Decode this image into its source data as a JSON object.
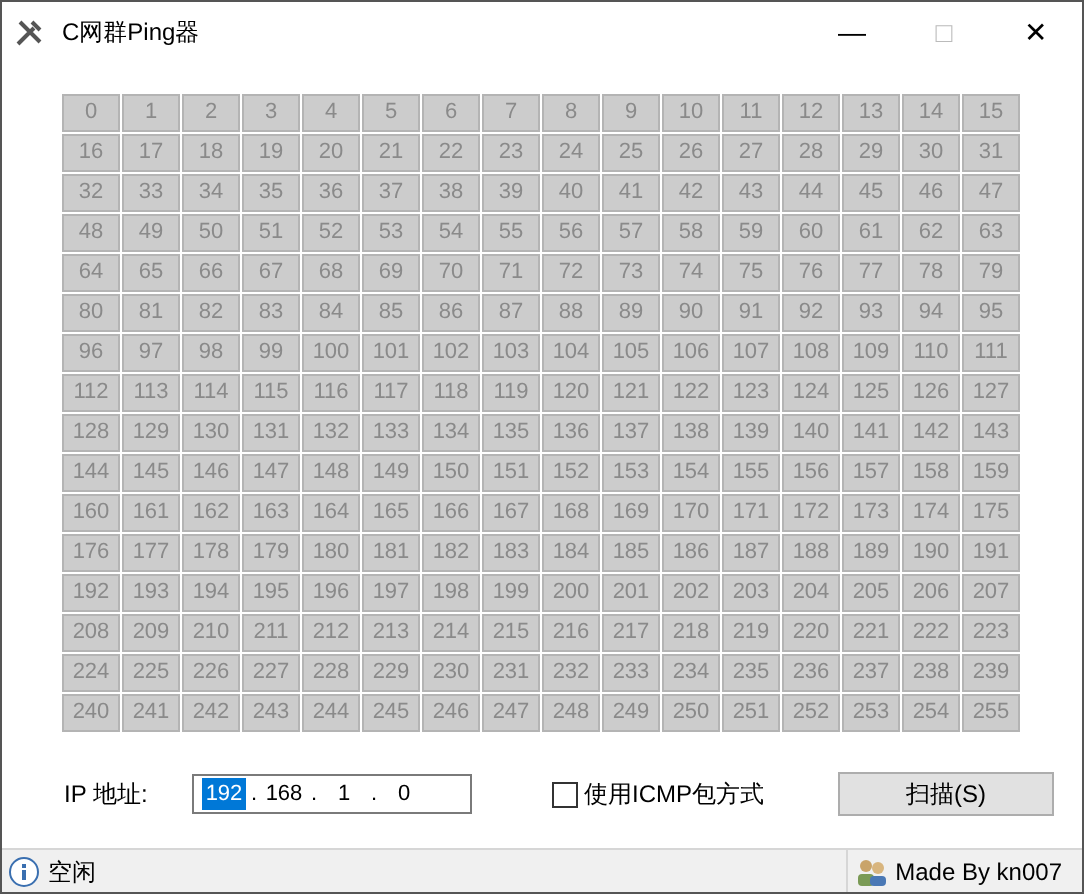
{
  "window": {
    "title": "C网群Ping器",
    "controls": [
      "—",
      "□",
      "✕"
    ]
  },
  "grid": {
    "disabled": true,
    "cells": [
      "0",
      "1",
      "2",
      "3",
      "4",
      "5",
      "6",
      "7",
      "8",
      "9",
      "10",
      "11",
      "12",
      "13",
      "14",
      "15",
      "16",
      "17",
      "18",
      "19",
      "20",
      "21",
      "22",
      "23",
      "24",
      "25",
      "26",
      "27",
      "28",
      "29",
      "30",
      "31",
      "32",
      "33",
      "34",
      "35",
      "36",
      "37",
      "38",
      "39",
      "40",
      "41",
      "42",
      "43",
      "44",
      "45",
      "46",
      "47",
      "48",
      "49",
      "50",
      "51",
      "52",
      "53",
      "54",
      "55",
      "56",
      "57",
      "58",
      "59",
      "60",
      "61",
      "62",
      "63",
      "64",
      "65",
      "66",
      "67",
      "68",
      "69",
      "70",
      "71",
      "72",
      "73",
      "74",
      "75",
      "76",
      "77",
      "78",
      "79",
      "80",
      "81",
      "82",
      "83",
      "84",
      "85",
      "86",
      "87",
      "88",
      "89",
      "90",
      "91",
      "92",
      "93",
      "94",
      "95",
      "96",
      "97",
      "98",
      "99",
      "100",
      "101",
      "102",
      "103",
      "104",
      "105",
      "106",
      "107",
      "108",
      "109",
      "110",
      "111",
      "112",
      "113",
      "114",
      "115",
      "116",
      "117",
      "118",
      "119",
      "120",
      "121",
      "122",
      "123",
      "124",
      "125",
      "126",
      "127",
      "128",
      "129",
      "130",
      "131",
      "132",
      "133",
      "134",
      "135",
      "136",
      "137",
      "138",
      "139",
      "140",
      "141",
      "142",
      "143",
      "144",
      "145",
      "146",
      "147",
      "148",
      "149",
      "150",
      "151",
      "152",
      "153",
      "154",
      "155",
      "156",
      "157",
      "158",
      "159",
      "160",
      "161",
      "162",
      "163",
      "164",
      "165",
      "166",
      "167",
      "168",
      "169",
      "170",
      "171",
      "172",
      "173",
      "174",
      "175",
      "176",
      "177",
      "178",
      "179",
      "180",
      "181",
      "182",
      "183",
      "184",
      "185",
      "186",
      "187",
      "188",
      "189",
      "190",
      "191",
      "192",
      "193",
      "194",
      "195",
      "196",
      "197",
      "198",
      "199",
      "200",
      "201",
      "202",
      "203",
      "204",
      "205",
      "206",
      "207",
      "208",
      "209",
      "210",
      "211",
      "212",
      "213",
      "214",
      "215",
      "216",
      "217",
      "218",
      "219",
      "220",
      "221",
      "222",
      "223",
      "224",
      "225",
      "226",
      "227",
      "228",
      "229",
      "230",
      "231",
      "232",
      "233",
      "234",
      "235",
      "236",
      "237",
      "238",
      "239",
      "240",
      "241",
      "242",
      "243",
      "244",
      "245",
      "246",
      "247",
      "248",
      "249",
      "250",
      "251",
      "252",
      "253",
      "254",
      "255"
    ]
  },
  "ip": {
    "label": "IP 地址:",
    "octets": [
      {
        "value": "192",
        "selected": true
      },
      {
        "value": "168",
        "selected": false
      },
      {
        "value": "1",
        "selected": false
      },
      {
        "value": "0",
        "selected": false
      }
    ],
    "separator": "."
  },
  "icmp": {
    "label": "使用ICMP包方式",
    "checked": false
  },
  "scan_button": {
    "label": "扫描(S)"
  },
  "status_bar": {
    "status": "空闲",
    "credit": "Made By kn007"
  }
}
